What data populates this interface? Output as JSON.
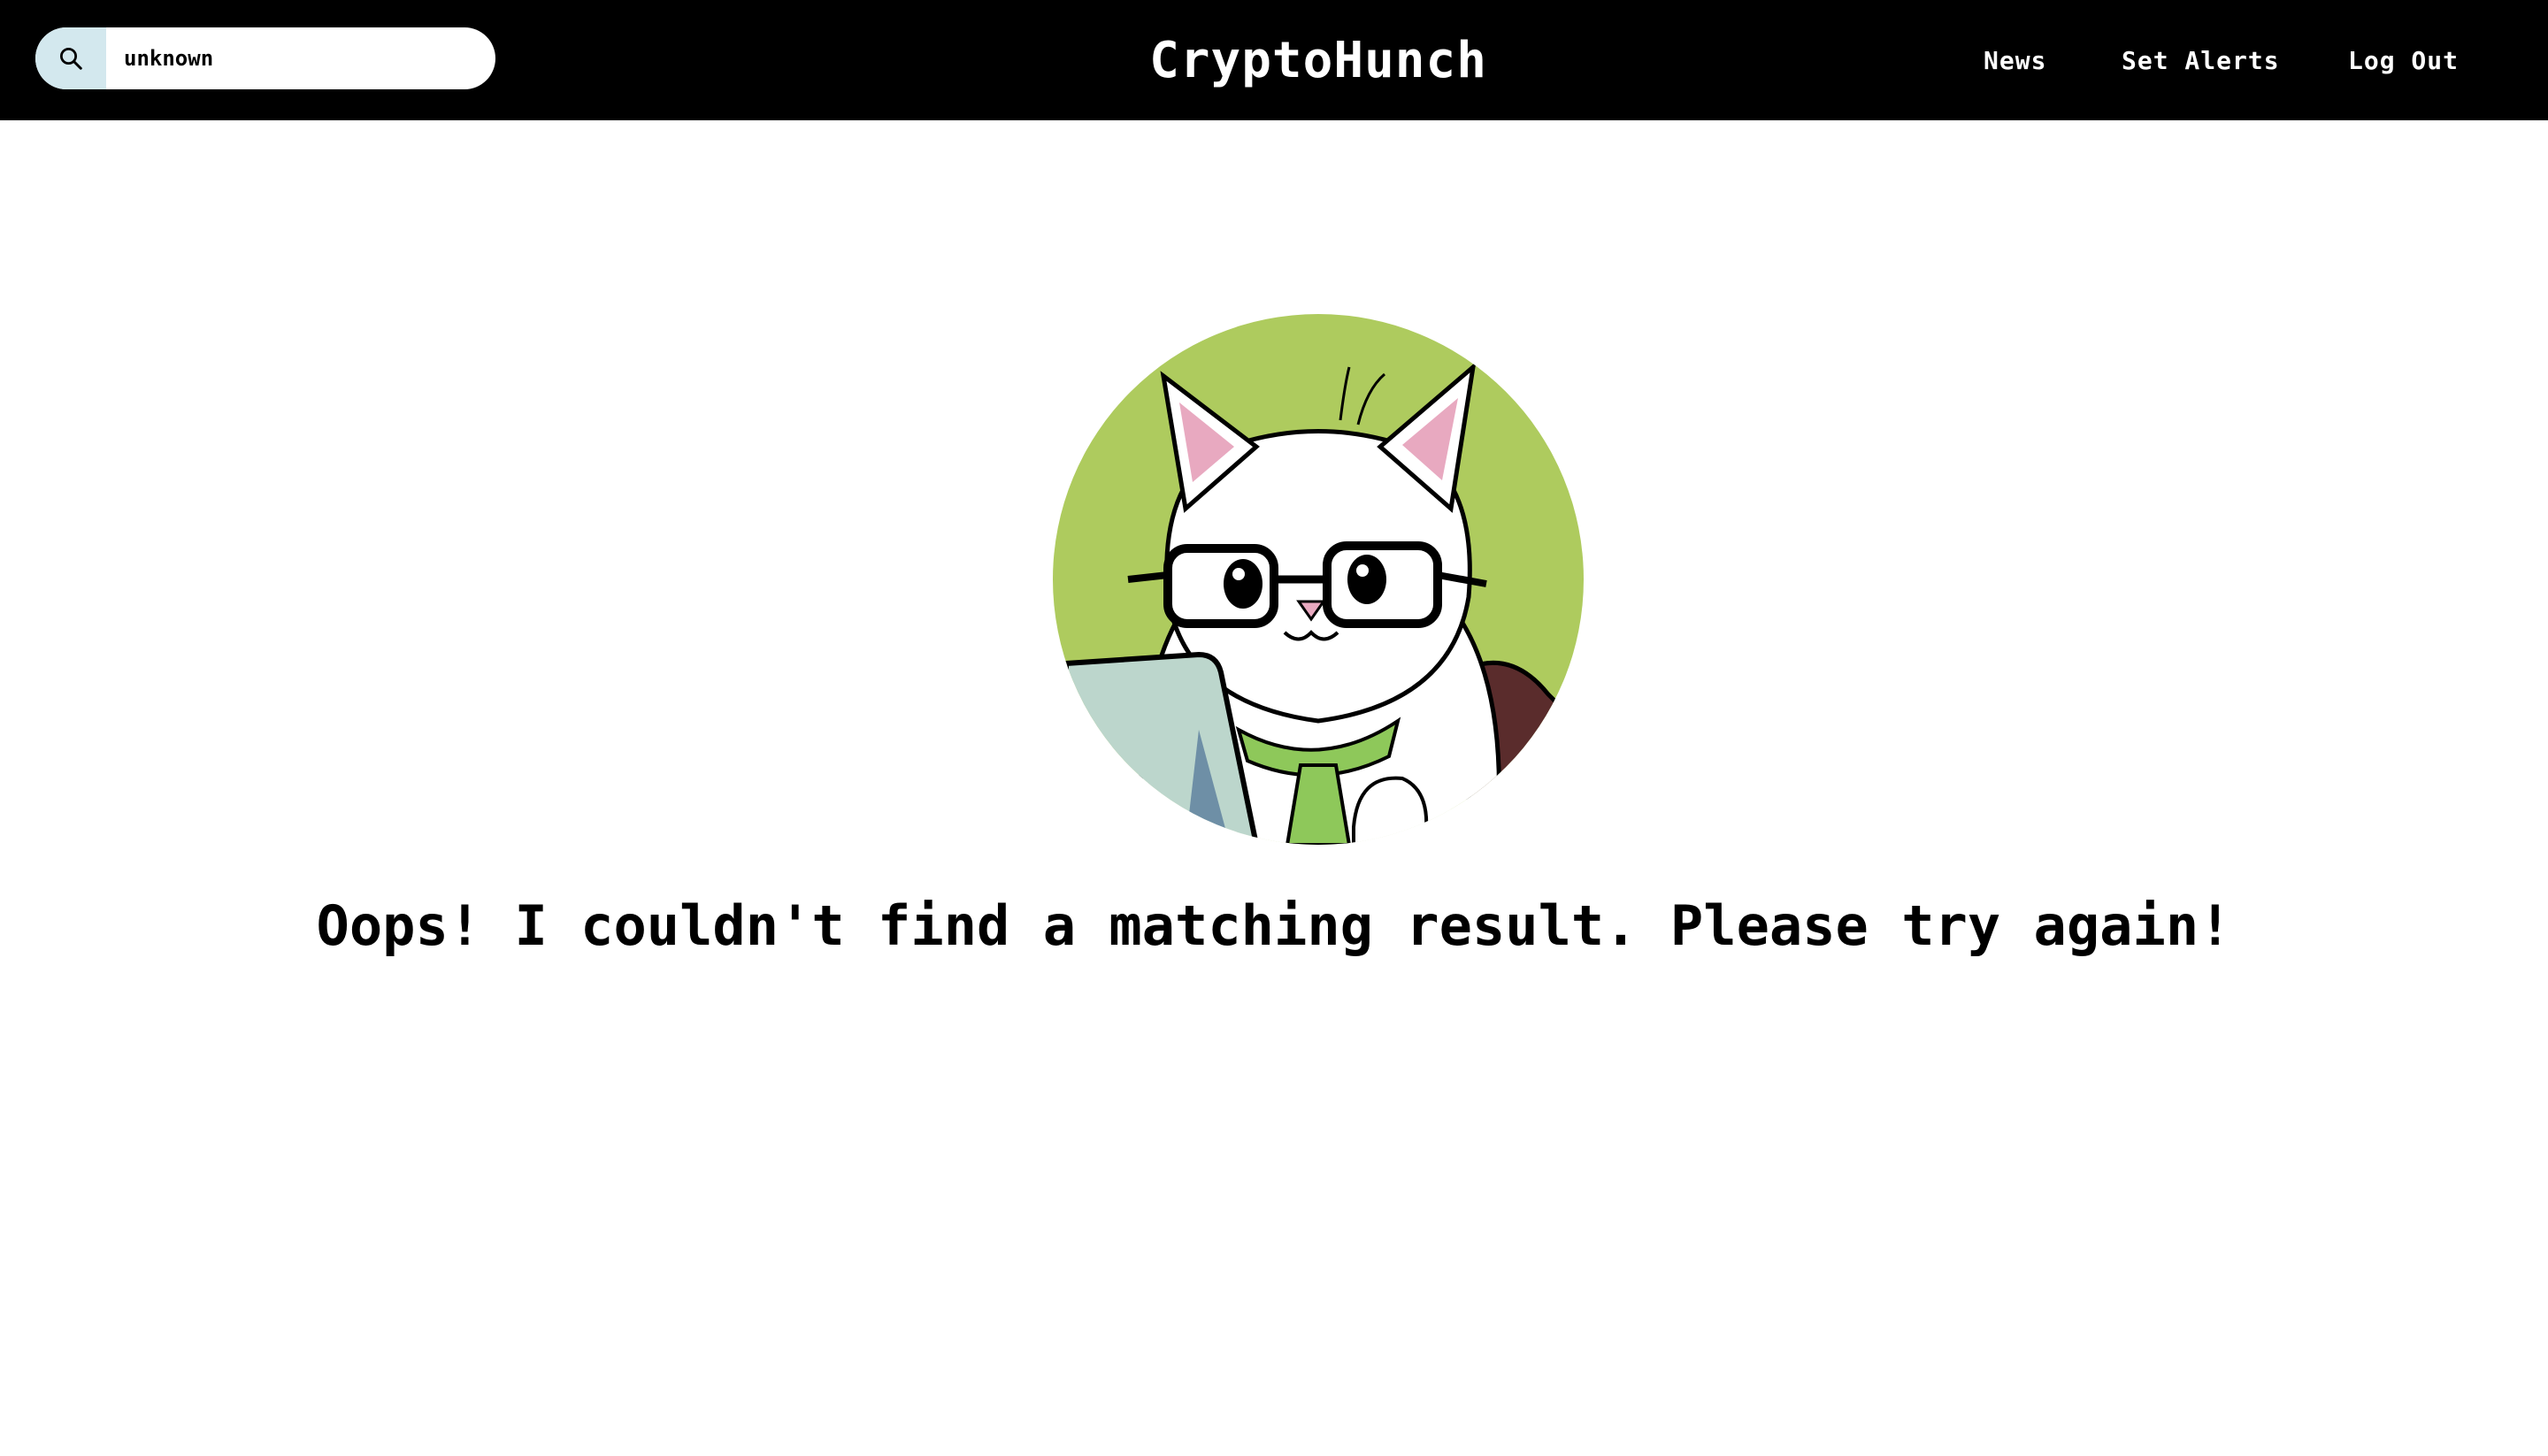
{
  "header": {
    "brand": "CryptoHunch",
    "search": {
      "value": "unknown",
      "icon": "search-icon"
    },
    "nav": [
      {
        "label": "News"
      },
      {
        "label": "Set Alerts"
      },
      {
        "label": "Log Out"
      }
    ]
  },
  "main": {
    "mascot": "cat-with-glasses-illustration",
    "message": "Oops! I couldn't find a matching result. Please try again!"
  },
  "colors": {
    "navbar_bg": "#000000",
    "search_button_bg": "#d3e8ee",
    "mascot_circle": "#aecb5e"
  }
}
